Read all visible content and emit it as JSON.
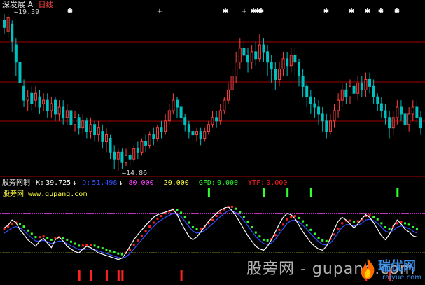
{
  "header": {
    "market": "深发展",
    "marker": "A",
    "timeframe": "日线"
  },
  "price_panel": {
    "high_label": "19.39",
    "low_label": "14.86"
  },
  "indicator": {
    "name": "股旁网制",
    "k_label": "K:",
    "k_value": "39.725",
    "k_arrow": "↓",
    "d_label": "D:",
    "d_value": "51.498",
    "d_arrow": "↓",
    "level_high": "80.000",
    "level_low": "20.000",
    "gfd_label": "GFD:",
    "gfd_value": "0.000",
    "ytf_label": "YTF:",
    "ytf_value": "0.000",
    "site_name": "股旁网",
    "site_url": "www.gupang.com"
  },
  "watermark": {
    "text": "股旁网 - gupang.com",
    "logo_text": "瑞优网",
    "logo_url": "raiyue.com"
  },
  "colors": {
    "background": "#000000",
    "up_candle": "#ff4040",
    "down_candle": "#00c0c0",
    "k_line": "#ffffff",
    "d_line": "#3050ff",
    "red_dots": "#ff2020",
    "green_dots": "#30ff30",
    "level_high": "#ff40ff",
    "level_low": "#ffff40",
    "gfd_bars": "#30ff30",
    "ytf_bars": "#ff2020",
    "separator": "#a00000"
  },
  "chart_data": {
    "type": "candlestick-with-oscillator",
    "price_ylim": [
      14.86,
      19.39
    ],
    "candles": [
      [
        19.2,
        19.0,
        19.39,
        18.8
      ],
      [
        18.9,
        19.3,
        19.39,
        18.7
      ],
      [
        19.1,
        18.6,
        19.2,
        18.3
      ],
      [
        18.5,
        18.0,
        18.7,
        17.6
      ],
      [
        18.0,
        17.4,
        18.1,
        17.0
      ],
      [
        17.3,
        16.9,
        17.5,
        16.7
      ],
      [
        16.9,
        17.0,
        17.2,
        16.6
      ],
      [
        17.1,
        16.8,
        17.3,
        16.6
      ],
      [
        16.9,
        17.1,
        17.3,
        16.7
      ],
      [
        17.0,
        16.7,
        17.2,
        16.5
      ],
      [
        16.8,
        16.9,
        17.1,
        16.6
      ],
      [
        16.9,
        16.6,
        17.1,
        16.4
      ],
      [
        16.6,
        16.8,
        17.0,
        16.4
      ],
      [
        16.9,
        16.5,
        17.0,
        16.3
      ],
      [
        16.5,
        16.7,
        16.9,
        16.3
      ],
      [
        16.7,
        16.4,
        16.9,
        16.2
      ],
      [
        16.4,
        16.6,
        16.8,
        16.2
      ],
      [
        16.6,
        16.2,
        16.7,
        16.0
      ],
      [
        16.2,
        16.4,
        16.6,
        16.0
      ],
      [
        16.4,
        16.1,
        16.5,
        15.9
      ],
      [
        16.1,
        16.3,
        16.5,
        15.9
      ],
      [
        16.3,
        16.0,
        16.4,
        15.8
      ],
      [
        16.0,
        16.2,
        16.4,
        15.8
      ],
      [
        16.2,
        15.9,
        16.3,
        15.7
      ],
      [
        15.9,
        16.1,
        16.3,
        15.7
      ],
      [
        16.0,
        15.7,
        16.2,
        15.5
      ],
      [
        15.7,
        15.9,
        16.1,
        15.4
      ],
      [
        15.8,
        15.4,
        15.9,
        15.2
      ],
      [
        15.4,
        15.2,
        15.6,
        14.9
      ],
      [
        15.2,
        15.4,
        15.5,
        14.86
      ],
      [
        15.4,
        15.1,
        15.5,
        14.9
      ],
      [
        15.1,
        15.3,
        15.5,
        15.0
      ],
      [
        15.3,
        15.2,
        15.4,
        15.0
      ],
      [
        15.2,
        15.5,
        15.6,
        15.1
      ],
      [
        15.5,
        15.4,
        15.7,
        15.2
      ],
      [
        15.4,
        15.7,
        15.8,
        15.3
      ],
      [
        15.7,
        15.6,
        15.9,
        15.4
      ],
      [
        15.6,
        15.9,
        16.0,
        15.5
      ],
      [
        15.9,
        15.8,
        16.1,
        15.6
      ],
      [
        15.8,
        16.1,
        16.2,
        15.7
      ],
      [
        16.1,
        16.0,
        16.3,
        15.8
      ],
      [
        16.0,
        16.3,
        16.5,
        15.9
      ],
      [
        16.3,
        16.6,
        16.8,
        16.2
      ],
      [
        16.6,
        16.9,
        17.1,
        16.5
      ],
      [
        16.9,
        16.7,
        17.0,
        16.4
      ],
      [
        16.7,
        16.4,
        16.8,
        16.2
      ],
      [
        16.4,
        16.2,
        16.5,
        16.0
      ],
      [
        16.2,
        16.0,
        16.3,
        15.8
      ],
      [
        16.0,
        15.9,
        16.1,
        15.7
      ],
      [
        15.9,
        16.0,
        16.1,
        15.7
      ],
      [
        16.0,
        15.8,
        16.1,
        15.6
      ],
      [
        15.8,
        16.0,
        16.1,
        15.7
      ],
      [
        16.0,
        16.2,
        16.3,
        15.9
      ],
      [
        16.2,
        16.4,
        16.6,
        16.1
      ],
      [
        16.4,
        16.3,
        16.6,
        16.1
      ],
      [
        16.3,
        16.6,
        16.8,
        16.2
      ],
      [
        16.6,
        16.9,
        17.0,
        16.5
      ],
      [
        16.9,
        17.2,
        17.4,
        16.8
      ],
      [
        17.2,
        17.6,
        17.8,
        17.0
      ],
      [
        17.6,
        18.0,
        18.3,
        17.4
      ],
      [
        18.0,
        18.4,
        18.7,
        17.8
      ],
      [
        18.4,
        18.2,
        18.6,
        18.0
      ],
      [
        18.2,
        18.0,
        18.4,
        17.7
      ],
      [
        18.0,
        18.3,
        18.5,
        17.8
      ],
      [
        18.3,
        18.1,
        18.6,
        17.9
      ],
      [
        18.1,
        18.5,
        18.8,
        18.0
      ],
      [
        18.5,
        18.3,
        18.7,
        18.0
      ],
      [
        18.3,
        18.0,
        18.5,
        17.6
      ],
      [
        18.0,
        17.8,
        18.2,
        17.4
      ],
      [
        17.8,
        17.5,
        18.0,
        17.2
      ],
      [
        17.5,
        17.8,
        18.0,
        17.3
      ],
      [
        17.8,
        18.1,
        18.3,
        17.6
      ],
      [
        18.1,
        17.9,
        18.3,
        17.6
      ],
      [
        17.9,
        18.2,
        18.4,
        17.7
      ],
      [
        18.2,
        18.0,
        18.4,
        17.6
      ],
      [
        18.0,
        17.6,
        18.1,
        17.3
      ],
      [
        17.6,
        17.3,
        17.8,
        17.0
      ],
      [
        17.3,
        17.0,
        17.4,
        16.7
      ],
      [
        17.0,
        16.8,
        17.2,
        16.5
      ],
      [
        16.8,
        16.7,
        17.0,
        16.4
      ],
      [
        16.7,
        16.5,
        16.9,
        16.2
      ],
      [
        16.5,
        16.3,
        16.7,
        16.0
      ],
      [
        16.3,
        16.0,
        16.5,
        15.8
      ],
      [
        16.0,
        16.3,
        16.5,
        15.9
      ],
      [
        16.3,
        16.6,
        16.8,
        16.1
      ],
      [
        16.6,
        16.9,
        17.1,
        16.4
      ],
      [
        16.9,
        17.2,
        17.4,
        16.7
      ],
      [
        17.2,
        17.0,
        17.4,
        16.8
      ],
      [
        17.0,
        17.3,
        17.5,
        16.8
      ],
      [
        17.3,
        17.1,
        17.5,
        16.9
      ],
      [
        17.1,
        17.4,
        17.6,
        16.9
      ],
      [
        17.4,
        17.2,
        17.6,
        17.0
      ],
      [
        17.2,
        17.5,
        17.7,
        17.0
      ],
      [
        17.5,
        17.3,
        17.7,
        17.1
      ],
      [
        17.3,
        17.0,
        17.5,
        16.8
      ],
      [
        17.0,
        16.8,
        17.1,
        16.6
      ],
      [
        16.8,
        16.6,
        17.0,
        16.4
      ],
      [
        16.6,
        16.4,
        16.8,
        16.2
      ],
      [
        16.4,
        16.1,
        16.6,
        15.8
      ],
      [
        16.1,
        16.4,
        16.6,
        15.9
      ],
      [
        16.4,
        16.7,
        16.9,
        16.2
      ],
      [
        16.7,
        16.5,
        16.9,
        16.3
      ],
      [
        16.5,
        16.2,
        16.7,
        16.0
      ],
      [
        16.2,
        16.5,
        16.7,
        16.0
      ],
      [
        16.5,
        16.7,
        16.9,
        16.3
      ],
      [
        16.7,
        16.4,
        16.9,
        16.2
      ],
      [
        16.4,
        16.1,
        16.6,
        15.9
      ]
    ],
    "k_line": [
      58,
      62,
      70,
      66,
      55,
      48,
      40,
      35,
      30,
      38,
      42,
      35,
      28,
      40,
      44,
      38,
      30,
      26,
      22,
      20,
      26,
      30,
      28,
      24,
      20,
      18,
      16,
      14,
      12,
      10,
      12,
      20,
      30,
      40,
      48,
      55,
      62,
      68,
      74,
      78,
      80,
      82,
      84,
      86,
      78,
      66,
      55,
      45,
      40,
      44,
      52,
      60,
      68,
      74,
      80,
      85,
      88,
      90,
      84,
      76,
      66,
      56,
      46,
      38,
      30,
      26,
      24,
      30,
      40,
      52,
      64,
      74,
      80,
      78,
      72,
      62,
      52,
      44,
      36,
      30,
      26,
      24,
      30,
      42,
      56,
      68,
      74,
      70,
      64,
      58,
      64,
      72,
      78,
      74,
      66,
      56,
      46,
      40,
      48,
      60,
      70,
      64,
      56,
      52,
      46,
      44
    ],
    "d_line": [
      50,
      54,
      58,
      60,
      58,
      54,
      48,
      43,
      38,
      38,
      39,
      37,
      34,
      36,
      38,
      37,
      34,
      31,
      28,
      25,
      25,
      26,
      26,
      25,
      23,
      21,
      19,
      17,
      15,
      13,
      12,
      14,
      19,
      26,
      33,
      40,
      47,
      54,
      60,
      66,
      70,
      74,
      77,
      80,
      79,
      75,
      68,
      60,
      53,
      50,
      51,
      54,
      59,
      64,
      70,
      75,
      80,
      84,
      84,
      81,
      76,
      69,
      61,
      53,
      45,
      39,
      34,
      33,
      35,
      41,
      49,
      57,
      65,
      69,
      70,
      67,
      62,
      56,
      49,
      43,
      37,
      33,
      32,
      35,
      42,
      51,
      59,
      63,
      63,
      61,
      62,
      65,
      70,
      71,
      69,
      65,
      59,
      53,
      51,
      54,
      59,
      61,
      59,
      57,
      53,
      50
    ],
    "level_high": 80,
    "level_low": 20,
    "gfd_signals": [
      52,
      66,
      72,
      78,
      100
    ],
    "ytf_signals": [
      19,
      22,
      26,
      29,
      30,
      45,
      92,
      98
    ]
  }
}
